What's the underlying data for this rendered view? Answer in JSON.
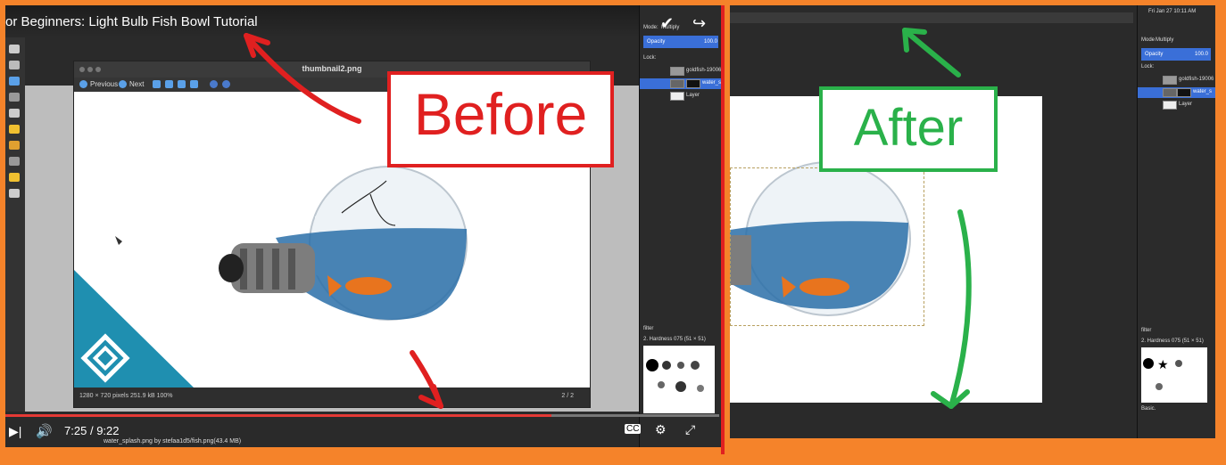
{
  "video": {
    "title": "or Beginners: Light Bulb Fish Bowl Tutorial",
    "time_current": "7:25",
    "time_separator": "/",
    "time_total": "9:22",
    "progress_fraction": 0.765,
    "bottom_caption": "water_splash.png by stefaa1d5/fish.png(43.4 MB)"
  },
  "viewer": {
    "title": "thumbnail2.png",
    "previous_label": "Previous",
    "next_label": "Next",
    "status_size": "1280 × 720 pixels  251.9 kB  100%",
    "status_page": "2 / 2"
  },
  "layers_panel": {
    "mode_label": "Mode:",
    "mode_value": "Multiply",
    "opacity_label": "Opacity",
    "opacity_value": "100.0",
    "lock_label": "Lock:",
    "layers": [
      {
        "name": "goldfish-19006"
      },
      {
        "name": "water_s"
      },
      {
        "name": "Layer"
      }
    ],
    "brush_filter": "filter",
    "brush_name": "2. Hardness 075 (51 × 51)"
  },
  "right_panel": {
    "clock": "Fri Jan 27 10:11 AM",
    "mode_label": "Mode",
    "mode_value": "Multiply",
    "opacity_label": "Opacity",
    "opacity_value": "100.0",
    "lock_label": "Lock:",
    "layers": [
      {
        "name": "goldfish-19006"
      },
      {
        "name": "water_s"
      },
      {
        "name": "Layer"
      }
    ],
    "brush_filter": "filter",
    "brush_name": "2. Hardness 075 (51 × 51)",
    "basic_label": "Basic."
  },
  "annotations": {
    "before": "Before",
    "after": "After"
  },
  "colors": {
    "frame": "#f5832a",
    "before": "#e02020",
    "after": "#2ab14a",
    "accent": "#3a6fd8"
  }
}
